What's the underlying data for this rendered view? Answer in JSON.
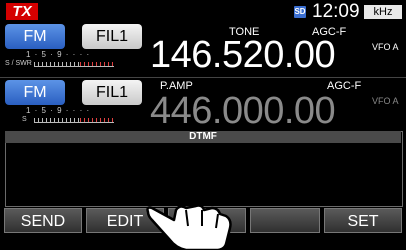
{
  "status": {
    "tx": "TX",
    "sd": "SD",
    "clock": "12:09",
    "unit": "kHz"
  },
  "main": {
    "mode": "FM",
    "filter": "FIL1",
    "tone_label": "TONE",
    "agc_label": "AGC-F",
    "meter_label": "S / SWR",
    "meter_scale": "1 · 5 · 9 · · · ·",
    "frequency": "146.520.00",
    "vfo_label": "VFO A"
  },
  "sub": {
    "mode": "FM",
    "filter": "FIL1",
    "pamp_label": "P.AMP",
    "agc_label": "AGC-F",
    "meter_label": "S",
    "meter_scale": "1 · 5 · 9 · · · ·",
    "frequency": "446.000.00",
    "vfo_label": "VFO A"
  },
  "dtmf": {
    "title": "DTMF"
  },
  "softkeys": {
    "send": "SEND",
    "edit": "EDIT",
    "set": "SET"
  },
  "colors": {
    "tx": "#d40000",
    "mode_button": "#3f78d8",
    "subfreq": "#8a8a8a"
  }
}
